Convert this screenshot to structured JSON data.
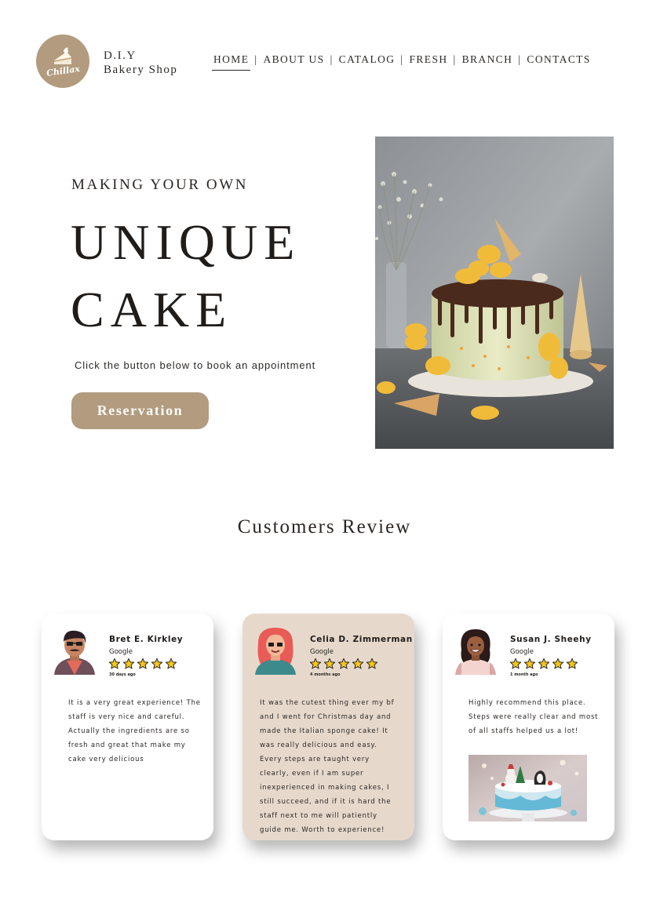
{
  "header": {
    "logo": {
      "icon": "cake-slice-icon",
      "text": "Chillax",
      "color": "#b29b7e"
    },
    "brand_line1": "D.I.Y",
    "brand_line2": "Bakery Shop",
    "nav": [
      {
        "label": "HOME",
        "active": true
      },
      {
        "label": "ABOUT US",
        "active": false
      },
      {
        "label": "CATALOG",
        "active": false
      },
      {
        "label": "FRESH",
        "active": false
      },
      {
        "label": "BRANCH",
        "active": false
      },
      {
        "label": "CONTACTS",
        "active": false
      }
    ],
    "separator": "|"
  },
  "hero": {
    "kicker": "MAKING YOUR OWN",
    "headline_line1": "UNIQUE",
    "headline_line2": "CAKE",
    "subtext": "Click the button below to book an appointment",
    "button_label": "Reservation",
    "accent_color": "#b29b7e"
  },
  "reviews": {
    "title": "Customers Review",
    "items": [
      {
        "name": "Bret E. Kirkley",
        "source": "Google",
        "rating": 5,
        "time": "30 days ago",
        "text": "It is a very great experience! The staff is very nice and careful. Actually the ingredients are so fresh and great that make my cake very delicious",
        "tinted": false
      },
      {
        "name": "Celia D. Zimmerman",
        "source": "Google",
        "rating": 5,
        "time": "4 months ago",
        "text": "It was the cutest thing ever my bf and I went for Christmas day and made the Italian sponge cake! It was really delicious and easy. Every steps are taught very clearly, even if I am super inexperienced in making cakes, I still succeed, and if it is hard the staff next to me will patiently guide me. Worth to experience!",
        "tinted": true
      },
      {
        "name": "Susan J. Sheehy",
        "source": "Google",
        "rating": 5,
        "time": "1 month ago",
        "text": "Highly recommend this place. Steps were really clear and most of all staffs helped us a lot!",
        "tinted": false
      }
    ],
    "star_color": "#f5c518",
    "card_tint": "#e6d9cc"
  }
}
